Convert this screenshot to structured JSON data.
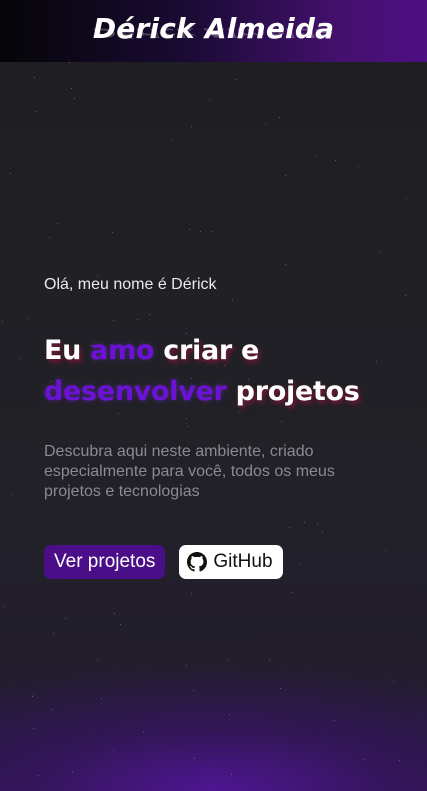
{
  "header": {
    "brand": "Dérick Almeida"
  },
  "hero": {
    "greeting": "Olá, meu nome é Dérick",
    "headline": {
      "part1": "Eu ",
      "accent1": "amo",
      "part2": " criar e ",
      "accent2": "desenvolver",
      "part3": " projetos"
    },
    "description": "Descubra aqui neste ambiente, criado especialmente para você, todos os meus projetos e tecnologias"
  },
  "actions": {
    "projects_label": "Ver projetos",
    "github_label": "GitHub",
    "github_icon": "github-icon"
  },
  "colors": {
    "accent": "#6b12d6",
    "button_primary": "#4a0e88",
    "background": "#1f1f23"
  }
}
